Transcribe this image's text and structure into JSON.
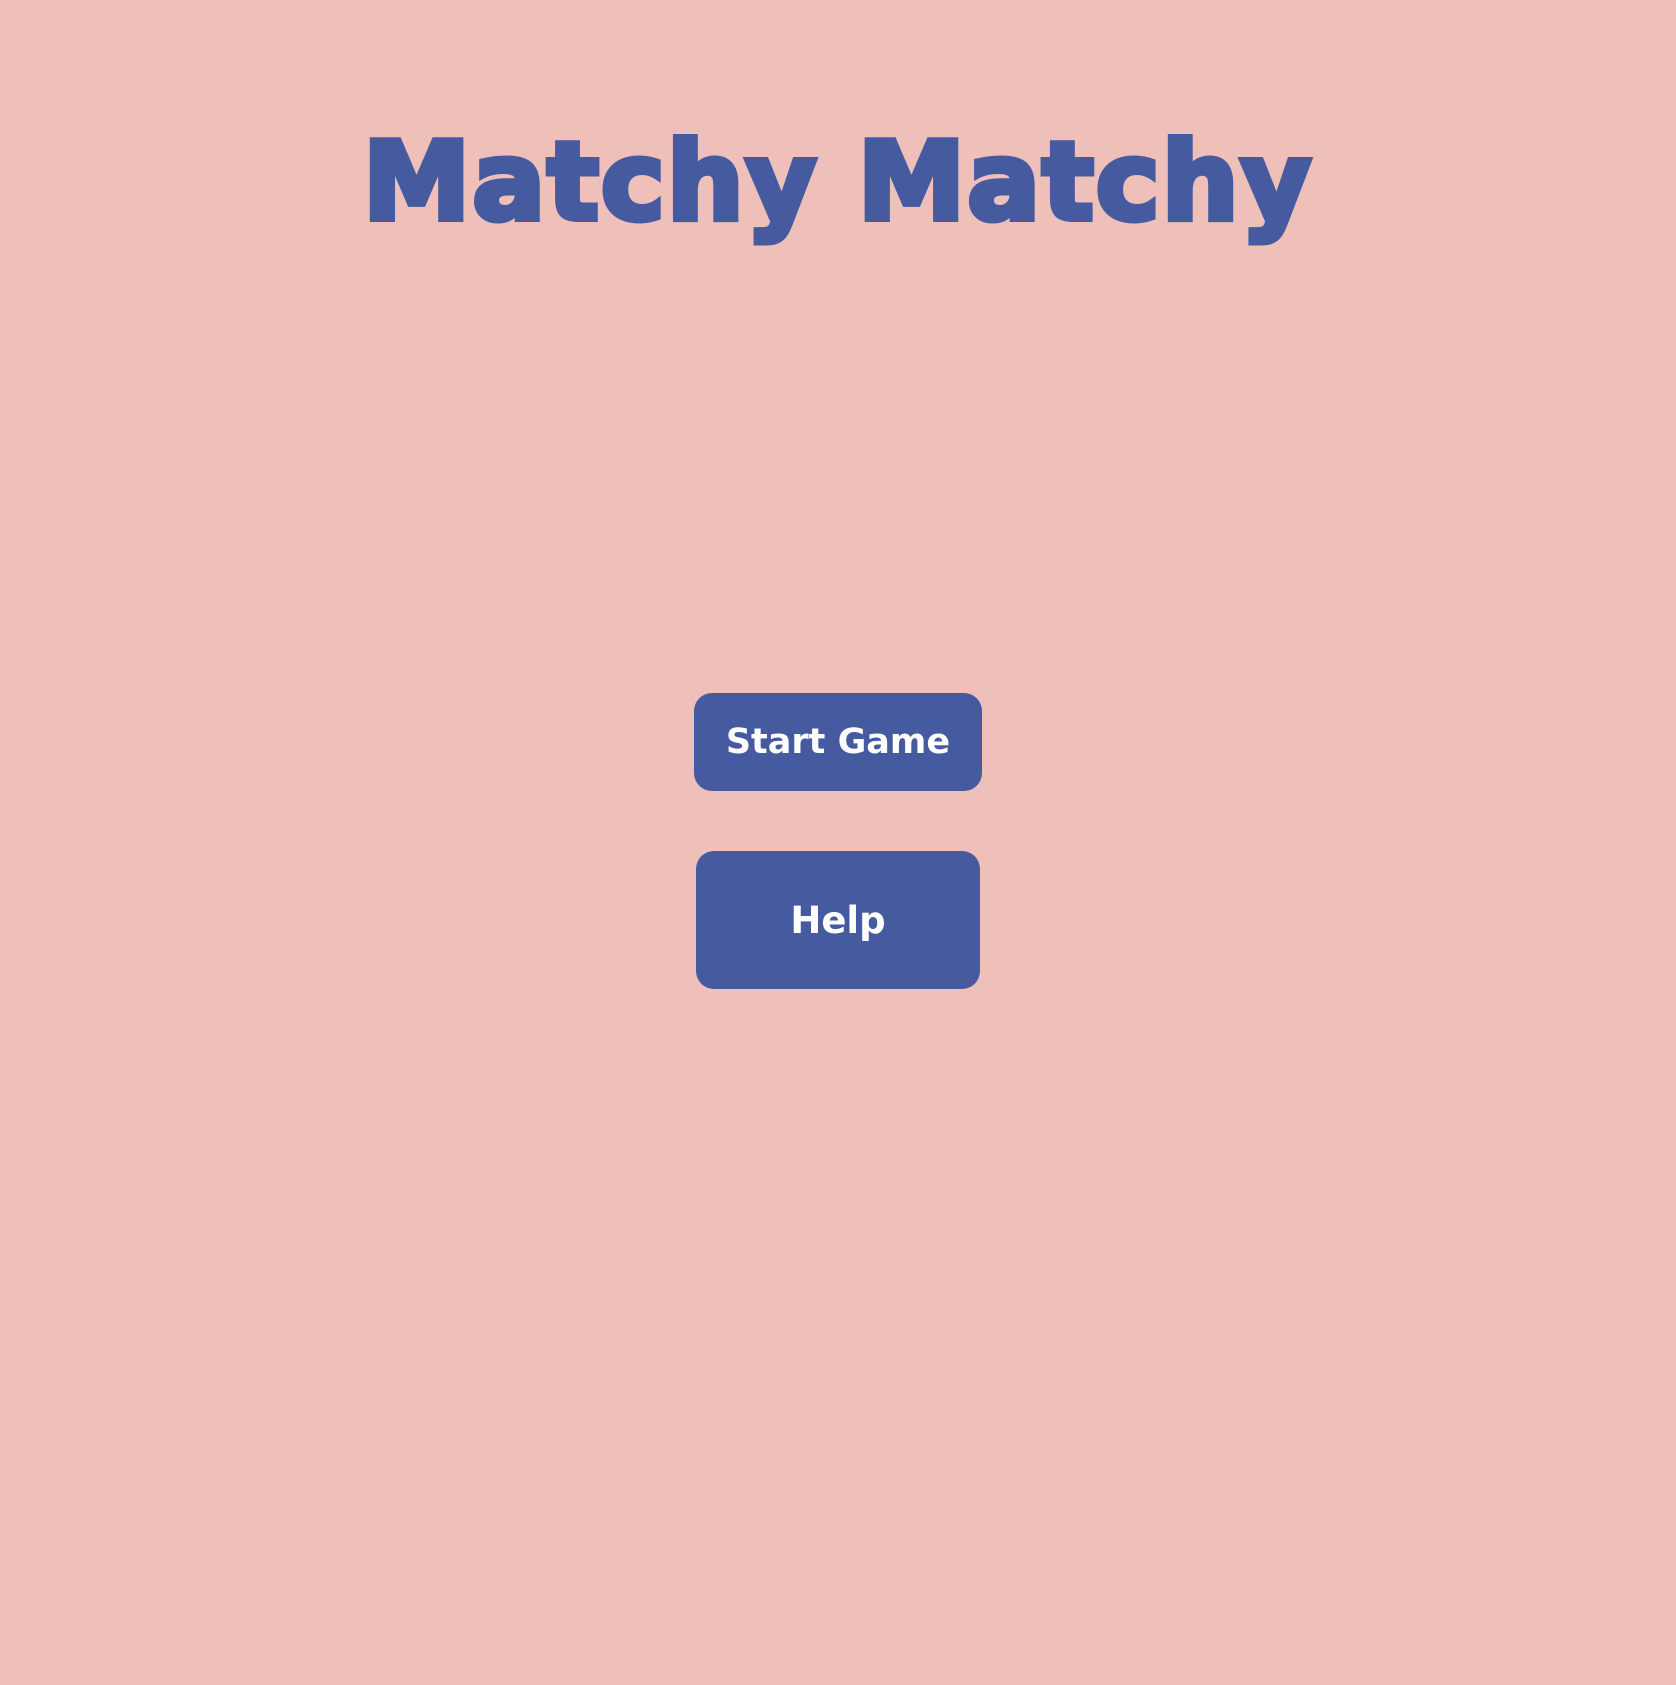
{
  "app": {
    "title": "Matchy Matchy"
  },
  "menu": {
    "start_label": "Start Game",
    "help_label": "Help"
  },
  "colors": {
    "background": "#efc0b9",
    "accent": "#465aa0",
    "button_text": "#ffffff"
  }
}
